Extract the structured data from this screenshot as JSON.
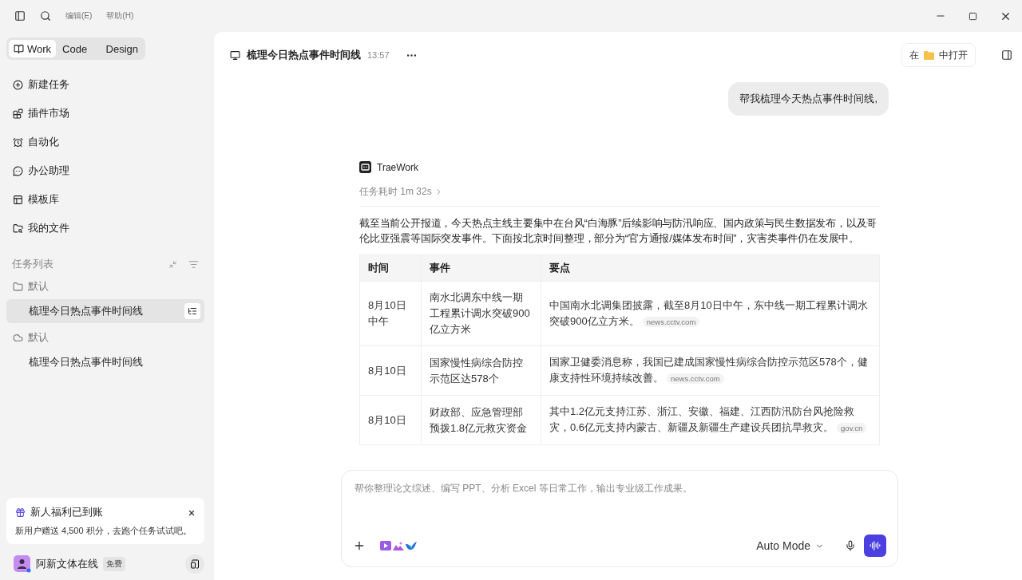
{
  "menu": [
    {
      "label": "编辑(E)"
    },
    {
      "label": "帮助(H)"
    }
  ],
  "modes": [
    {
      "label": "Work",
      "selected": true
    },
    {
      "label": "Code",
      "selected": false
    },
    {
      "label": "Design",
      "selected": false
    }
  ],
  "nav": [
    {
      "label": "新建任务"
    },
    {
      "label": "插件市场"
    },
    {
      "label": "自动化"
    },
    {
      "label": "办公助理"
    },
    {
      "label": "模板库"
    },
    {
      "label": "我的文件"
    }
  ],
  "task_list": {
    "title": "任务列表",
    "groups": [
      {
        "label": "默认",
        "kind": "local",
        "children": [
          {
            "label": "梳理今日热点事件时间线",
            "selected": true
          }
        ]
      },
      {
        "label": "默认",
        "kind": "cloud",
        "children": [
          {
            "label": "梳理今日热点事件时间线",
            "selected": false
          }
        ]
      }
    ]
  },
  "promo": {
    "title": "新人福利已到账",
    "text": "新用户赠送 4,500 积分，去跑个任务试试吧。"
  },
  "user": {
    "name": "阿新文体在线",
    "badge": "免费"
  },
  "chat": {
    "title": "梳理今日热点事件时间线",
    "time": "13:57",
    "open_prefix": "在",
    "open_suffix": "中打开",
    "user_message": "帮我梳理今天热点事件时间线,",
    "agent_name": "TraeWork",
    "duration": "任务耗时 1m 32s",
    "intro": "截至当前公开报道，今天热点主线主要集中在台风“白海豚”后续影响与防汛响应、国内政策与民生数据发布，以及哥伦比亚强震等国际突发事件。下面按北京时间整理，部分为“官方通报/媒体发布时间”，灾害类事件仍在发展中。",
    "table": {
      "columns": [
        "时间",
        "事件",
        "要点"
      ],
      "rows": [
        {
          "time": "8月10日中午",
          "event": "南水北调东中线一期工程累计调水突破900亿立方米",
          "detail": {
            "text": "中国南水北调集团披露，截至8月10日中午，东中线一期工程累计调水突破900亿立方米。",
            "source": "news.cctv.com"
          }
        },
        {
          "time": "8月10日",
          "event": "国家慢性病综合防控示范区达578个",
          "detail": {
            "text": "国家卫健委消息称，我国已建成国家慢性病综合防控示范区578个，健康支持性环境持续改善。",
            "source": "news.cctv.com"
          }
        },
        {
          "time": "8月10日",
          "event": "财政部、应急管理部预拨1.8亿元救灾资金",
          "detail": {
            "text": "其中1.2亿元支持江苏、浙江、安徽、福建、江西防汛防台风抢险救灾，0.6亿元支持内蒙古、新疆及新疆生产建设兵团抗旱救灾。",
            "source": "gov.cn"
          }
        }
      ]
    }
  },
  "composer": {
    "placeholder": "帮你整理论文综述、编写 PPT、分析 Excel 等日常工作，输出专业级工作成果。",
    "mode": "Auto Mode"
  }
}
